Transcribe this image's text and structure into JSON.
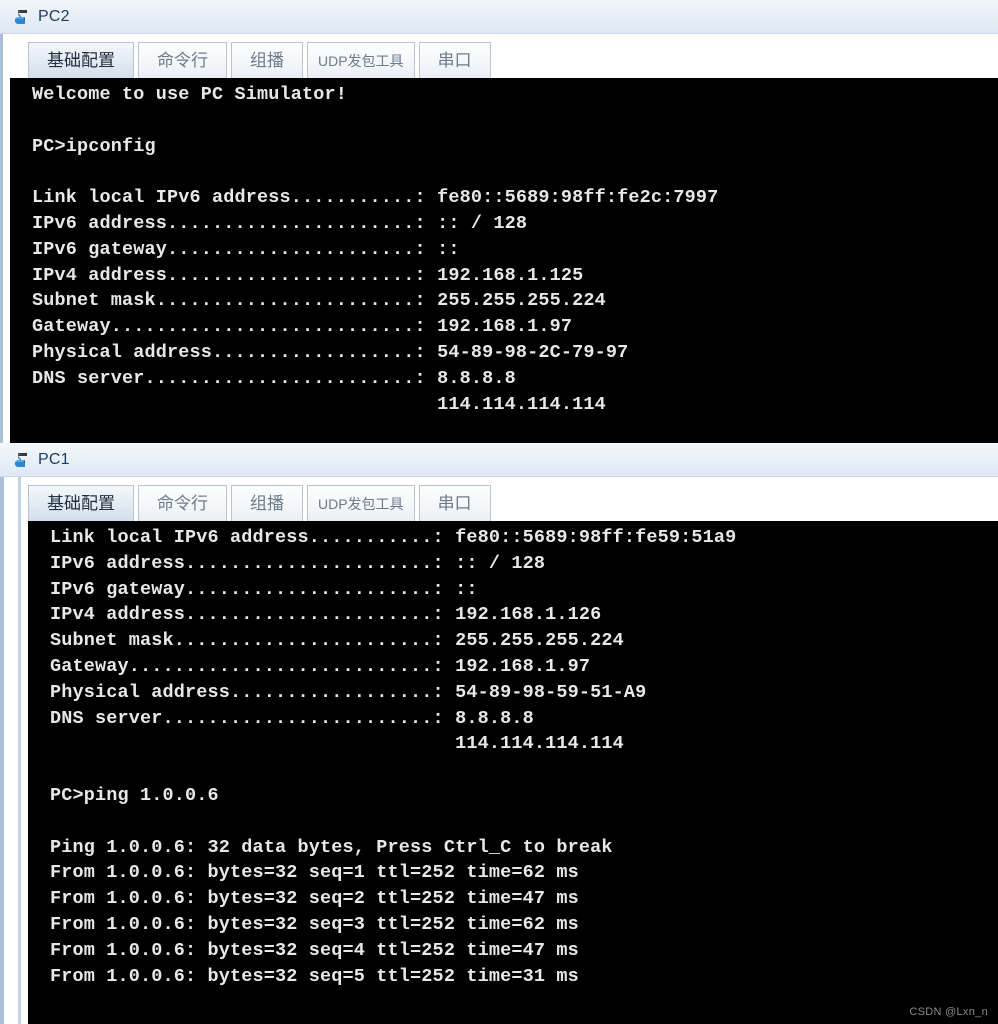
{
  "windows": [
    {
      "id": "pc2",
      "title": "PC2",
      "icon": "pc-device-icon",
      "tabs": [
        {
          "label": "基础配置",
          "selected": true
        },
        {
          "label": "命令行",
          "selected": false
        },
        {
          "label": "组播",
          "selected": false
        },
        {
          "label": "UDP发包工具",
          "selected": false
        },
        {
          "label": "串口",
          "selected": false
        }
      ],
      "terminal_lines": [
        "Welcome to use PC Simulator!",
        "",
        "PC>ipconfig",
        "",
        "Link local IPv6 address...........: fe80::5689:98ff:fe2c:7997",
        "IPv6 address......................: :: / 128",
        "IPv6 gateway......................: ::",
        "IPv4 address......................: 192.168.1.125",
        "Subnet mask.......................: 255.255.255.224",
        "Gateway...........................: 192.168.1.97",
        "Physical address..................: 54-89-98-2C-79-97",
        "DNS server........................: 8.8.8.8",
        "                                    114.114.114.114"
      ]
    },
    {
      "id": "pc1",
      "title": "PC1",
      "icon": "pc-device-icon",
      "tabs": [
        {
          "label": "基础配置",
          "selected": true
        },
        {
          "label": "命令行",
          "selected": false
        },
        {
          "label": "组播",
          "selected": false
        },
        {
          "label": "UDP发包工具",
          "selected": false
        },
        {
          "label": "串口",
          "selected": false
        }
      ],
      "terminal_lines": [
        "Link local IPv6 address...........: fe80::5689:98ff:fe59:51a9",
        "IPv6 address......................: :: / 128",
        "IPv6 gateway......................: ::",
        "IPv4 address......................: 192.168.1.126",
        "Subnet mask.......................: 255.255.255.224",
        "Gateway...........................: 192.168.1.97",
        "Physical address..................: 54-89-98-59-51-A9",
        "DNS server........................: 8.8.8.8",
        "                                    114.114.114.114",
        "",
        "PC>ping 1.0.0.6",
        "",
        "Ping 1.0.0.6: 32 data bytes, Press Ctrl_C to break",
        "From 1.0.0.6: bytes=32 seq=1 ttl=252 time=62 ms",
        "From 1.0.0.6: bytes=32 seq=2 ttl=252 time=47 ms",
        "From 1.0.0.6: bytes=32 seq=3 ttl=252 time=62 ms",
        "From 1.0.0.6: bytes=32 seq=4 ttl=252 time=47 ms",
        "From 1.0.0.6: bytes=32 seq=5 ttl=252 time=31 ms"
      ]
    }
  ],
  "watermark": "CSDN @Lxn_n",
  "colors": {
    "terminal_bg": "#000000",
    "terminal_fg": "#e8e8e8",
    "title_text": "#1f3c63",
    "icon_blue": "#1f7fd0",
    "tab_border": "#b7c4d4"
  }
}
